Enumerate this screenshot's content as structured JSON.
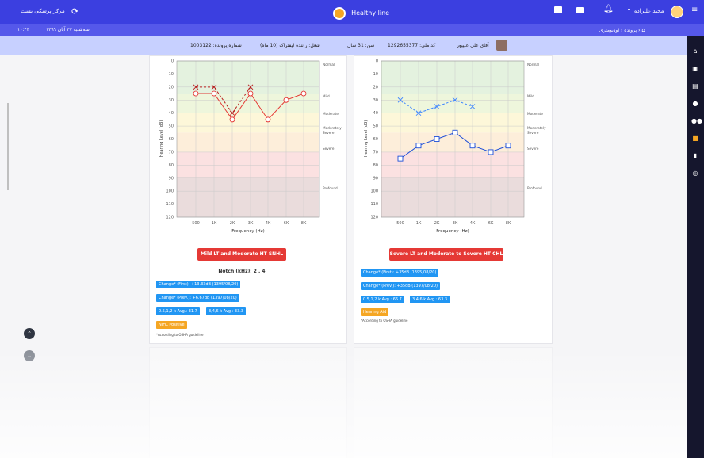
{
  "topbar": {
    "logo_text": "Healthy line",
    "right_title": "مرکز پزشکی تست",
    "user_name": "مجید علیزاده",
    "icons": [
      "menu-icon",
      "user-avatar",
      "chevron-down-icon",
      "bell-icon",
      "folder-icon",
      "chat-icon",
      "refresh-icon"
    ]
  },
  "subbar": {
    "date_text": "سه‌شنبه ۲۷ آبان ۱۳۹۹",
    "time_text": "۱۰:۴۳",
    "breadcrumb_home": "",
    "breadcrumb_file": "پرونده",
    "breadcrumb_page": "اودیومتری"
  },
  "patient": {
    "name": "آقای علی علیپور",
    "national_code": "کد ملی: 1292655377",
    "age": "سن: 31 سال",
    "job": "شغل: راننده لیفتراک (10 ماه)",
    "file_no": "شماره پرونده: 1003122"
  },
  "charts": {
    "y_axis_label": "Hearing Level (dB)",
    "x_axis_label": "Frequency (Hz)",
    "y_ticks": [
      "0",
      "10",
      "20",
      "30",
      "40",
      "50",
      "60",
      "70",
      "80",
      "90",
      "100",
      "110",
      "120"
    ],
    "x_ticks": [
      "500",
      "1K",
      "2K",
      "3K",
      "4K",
      "6K",
      "8K"
    ],
    "zones": [
      "Normal",
      "Mild",
      "Moderate",
      "Moderately Severe",
      "Severe",
      "Profound"
    ]
  },
  "chart_data": [
    {
      "type": "line",
      "title": "",
      "x": [
        "500",
        "1K",
        "2K",
        "3K",
        "4K",
        "6K",
        "8K"
      ],
      "xlabel": "Frequency (Hz)",
      "ylabel": "Hearing Level (dB)",
      "ylim": [
        0,
        120
      ],
      "y_inverted": true,
      "series": [
        {
          "values": [
            25,
            25,
            45,
            25,
            45,
            30,
            25
          ],
          "style": "solid",
          "marker": "circle",
          "color": "#e53935"
        },
        {
          "values": [
            20,
            20,
            40,
            20,
            null,
            null,
            null
          ],
          "style": "dashed",
          "marker": "x",
          "color": "#b71c1c"
        }
      ]
    },
    {
      "type": "line",
      "title": "",
      "x": [
        "500",
        "1K",
        "2K",
        "3K",
        "4K",
        "6K",
        "8K"
      ],
      "xlabel": "Frequency (Hz)",
      "ylabel": "Hearing Level (dB)",
      "ylim": [
        0,
        120
      ],
      "y_inverted": true,
      "series": [
        {
          "values": [
            75,
            65,
            60,
            55,
            65,
            70,
            65
          ],
          "style": "solid",
          "marker": "square",
          "color": "#1e4fd8"
        },
        {
          "values": [
            30,
            40,
            35,
            30,
            35,
            null,
            null
          ],
          "style": "dashed",
          "marker": "x",
          "color": "#3f86ff"
        }
      ]
    }
  ],
  "left_card": {
    "diagnosis": "Mild LT and Moderate HT SNHL",
    "notch": "Notch (kHz): 2 , 4",
    "chip1": "Change* (First): +13.33dB (1395/08/20)",
    "chip2": "Change* (Prev.): +6.67dB (1397/08/20)",
    "chip3": "0.5,1,2 k Avg.: 31.7",
    "chip4": "3,4,6 k Avg.: 33.3",
    "chip5": "NIHL Positive",
    "note": "*According to OSHA guideline"
  },
  "right_card": {
    "diagnosis": "Severe LT and Moderate to Severe HT CHL",
    "chip1": "Change* (First): +35dB (1395/08/20)",
    "chip2": "Change* (Prev.): +35dB (1397/08/20)",
    "chip3": "0.5,1,2 k Avg.: 66.7",
    "chip4": "3,4,6 k Avg.: 63.3",
    "chip5": "Hearing Aid",
    "note": "*According to OSHA guideline"
  },
  "colors": {
    "topbar": "#3b3fe0",
    "subbar": "#5558ea",
    "patient_bar": "#c7d0ff",
    "zone_normal": "#e4f2df",
    "zone_mild": "#eef6dc",
    "zone_moderate": "#fdf7d9",
    "zone_mod_severe": "#fdeeda",
    "zone_severe": "#fbe1e1",
    "zone_profound": "#eadcdc"
  }
}
